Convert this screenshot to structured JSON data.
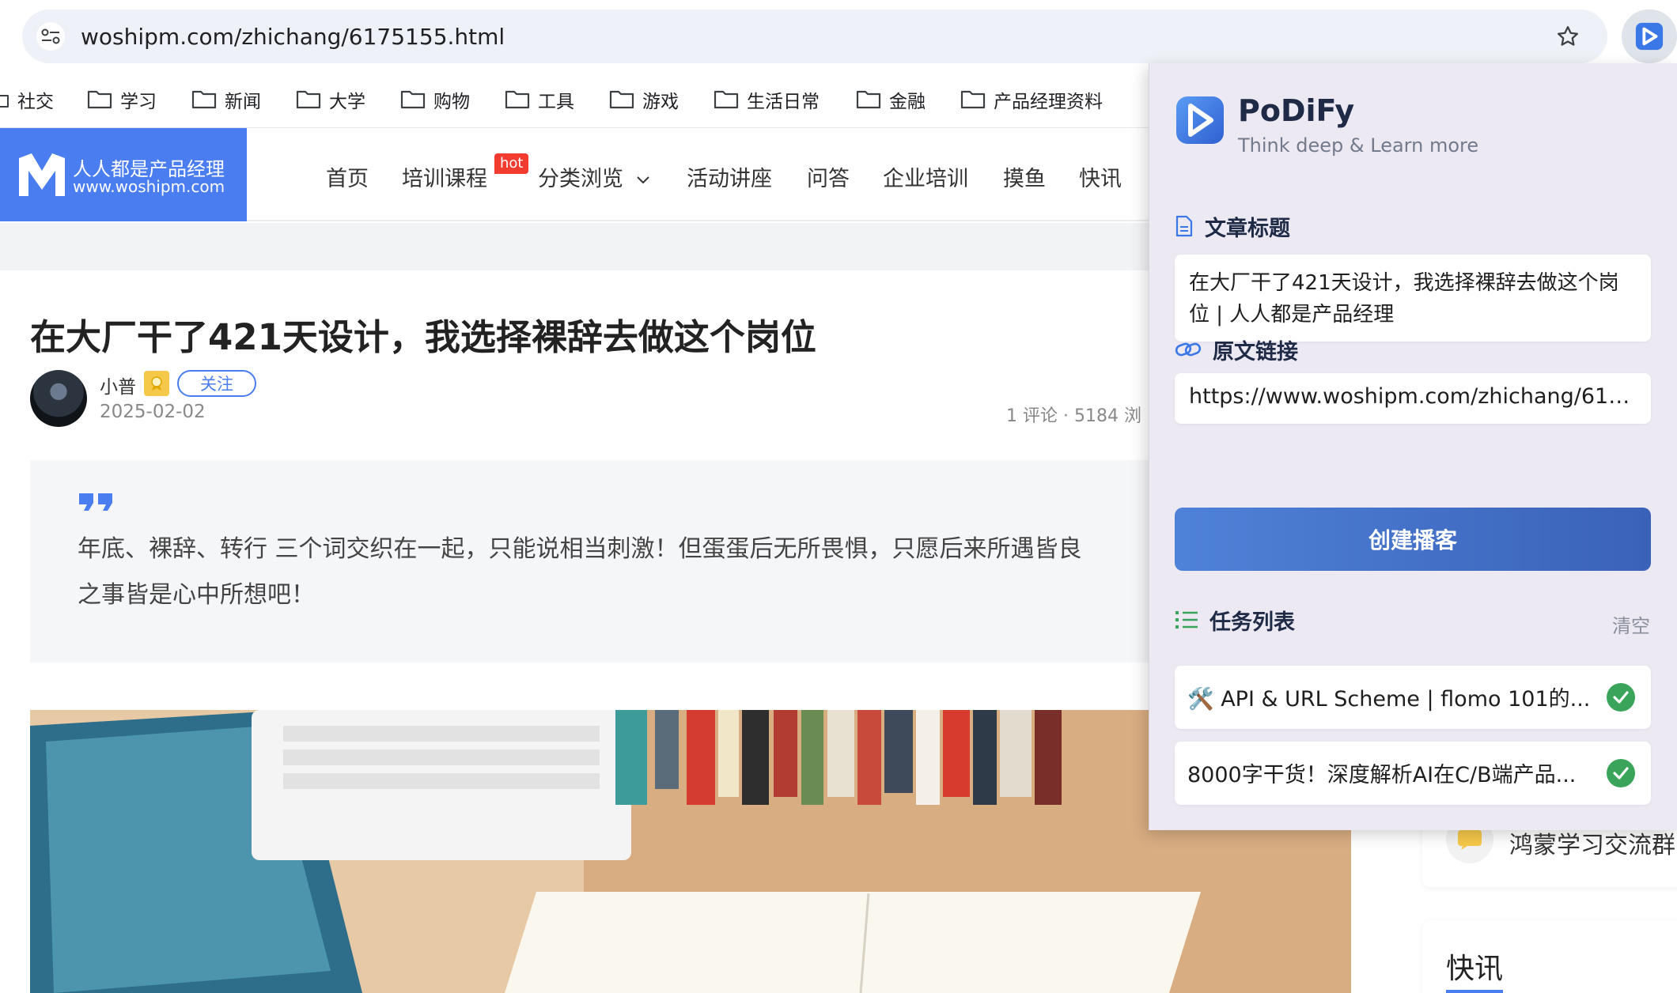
{
  "browser": {
    "url": "woshipm.com/zhichang/6175155.html",
    "icons": {
      "tune": "tune-icon",
      "star": "bookmark-star-icon",
      "extension": "podify-extension-icon"
    }
  },
  "bookmarks": [
    "社交",
    "学习",
    "新闻",
    "大学",
    "购物",
    "工具",
    "游戏",
    "生活日常",
    "金融",
    "产品经理资料"
  ],
  "site": {
    "logo_cn": "人人都是产品经理",
    "logo_en": "www.woshipm.com",
    "nav": [
      "首页",
      "培训课程",
      "分类浏览",
      "活动讲座",
      "问答",
      "企业培训",
      "摸鱼",
      "快讯"
    ],
    "hot_badge": "hot",
    "accent": "#4a7df0"
  },
  "article": {
    "title": "在大厂干了421天设计，我选择裸辞去做这个岗位",
    "author": "小普",
    "follow_label": "关注",
    "date": "2025-02-02",
    "stats": "1 评论 · 5184 浏",
    "quote": "年底、裸辞、转行 三个词交织在一起，只能说相当刺激！但蛋蛋后无所畏惧，只愿后来所遇皆良",
    "quote_line2": "之事皆是心中所想吧！"
  },
  "sidebar": {
    "group_label": "鸿蒙学习交流群",
    "news_label": "快讯"
  },
  "podify": {
    "name": "PoDiFy",
    "tagline": "Think deep & Learn more",
    "title_section": "文章标题",
    "title_value": "在大厂干了421天设计，我选择裸辞去做这个岗位 | 人人都是产品经理",
    "url_section": "原文链接",
    "url_value": "https://www.woshipm.com/zhichang/617...",
    "create_label": "创建播客",
    "tasks_section": "任务列表",
    "clear_label": "清空",
    "tasks": [
      {
        "label": "🛠️ API & URL Scheme | flomo 101的...",
        "status": "done"
      },
      {
        "label": "8000字干货！深度解析AI在C/B端产品...",
        "status": "done"
      }
    ],
    "colors": {
      "button": "#4e82d8",
      "check": "#3aa55a",
      "panel": "#ece9f3"
    }
  }
}
